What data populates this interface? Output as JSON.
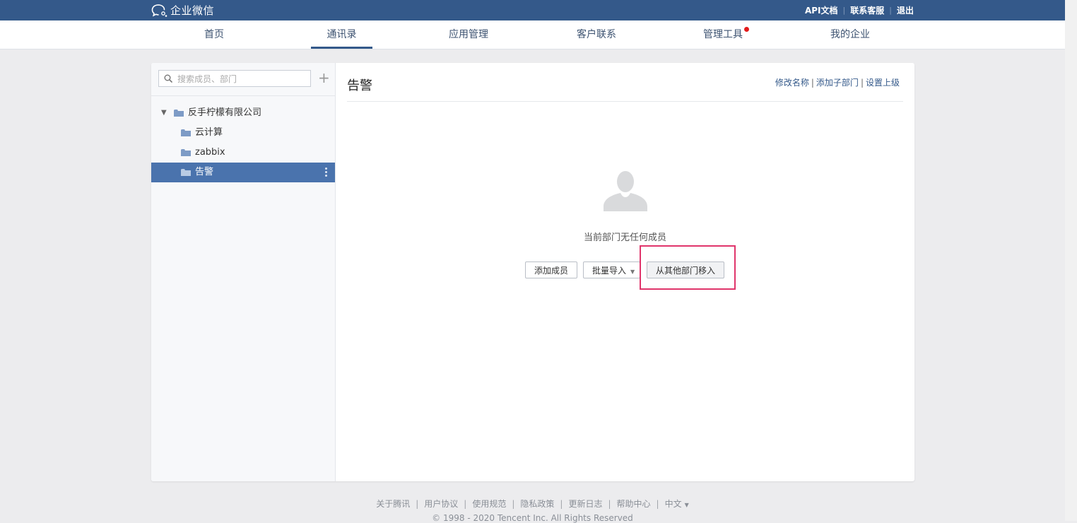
{
  "header": {
    "logo_text": "企业微信",
    "links": [
      "API文档",
      "联系客服",
      "退出"
    ]
  },
  "nav": {
    "items": [
      "首页",
      "通讯录",
      "应用管理",
      "客户联系",
      "管理工具",
      "我的企业"
    ],
    "active": "通讯录",
    "badge_item": "管理工具",
    "badge_color": "#e31b1b"
  },
  "sidebar": {
    "search_placeholder": "搜索成员、部门",
    "plus": "+",
    "root": "反手柠檬有限公司",
    "departments": [
      "云计算",
      "zabbix",
      "告警"
    ],
    "selected": "告警"
  },
  "main": {
    "title": "告警",
    "actions": [
      "修改名称",
      "添加子部门",
      "设置上级"
    ],
    "empty_text": "当前部门无任何成员",
    "buttons": {
      "add_member": "添加成员",
      "batch_import": "批量导入",
      "move_from_other": "从其他部门移入"
    }
  },
  "footer": {
    "links": [
      "关于腾讯",
      "用户协议",
      "使用规范",
      "隐私政策",
      "更新日志",
      "帮助中心"
    ],
    "language": "中文",
    "copyright": "© 1998 - 2020 Tencent Inc. All Rights Reserved"
  },
  "colors": {
    "topbar": "#34598a",
    "selected_row": "#4a73ad",
    "highlight_box": "#e0356b"
  }
}
